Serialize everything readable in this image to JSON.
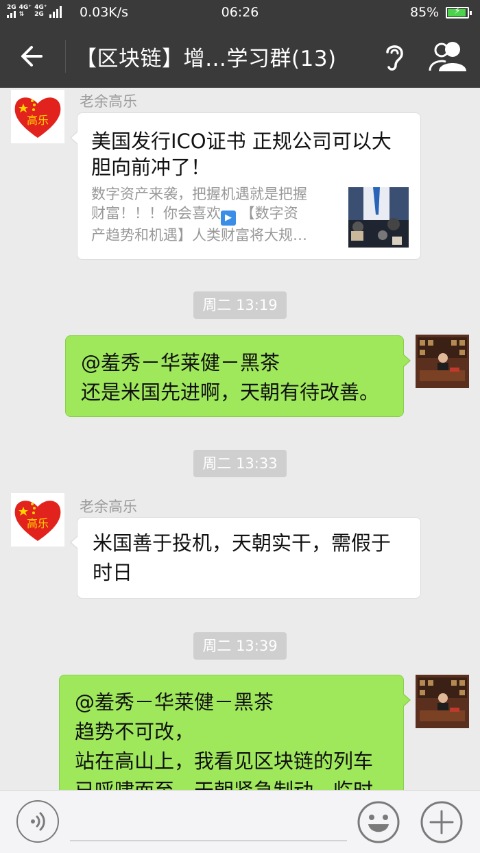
{
  "status_bar": {
    "signal_text_1": "2G",
    "signal_text_2": "4G⁺",
    "signal_text_3": "4G⁺",
    "signal_text_4": "2G",
    "speed": "0.03K/s",
    "time": "06:26",
    "battery": "85%",
    "battery_level": 0.85
  },
  "header": {
    "title": "【区块链】增…学习群(13)",
    "icons": [
      "back-arrow-icon",
      "ear-icon",
      "group-people-icon"
    ]
  },
  "messages": [
    {
      "type": "link_card",
      "side": "left",
      "sender": "老余高乐",
      "avatar_text": "高乐",
      "card_title_line1": "美国发行ICO证书 正规公司可以大",
      "card_title_line2": "胆向前冲了！",
      "card_desc_line1": "数字资产来袭，把握机遇就是把握",
      "card_desc_line2_a": "财富！！！你会喜欢",
      "card_desc_line2_b": " 【数字资",
      "card_desc_line3": "产趋势和机遇】人类财富将大规…"
    },
    {
      "type": "timestamp",
      "text": "周二 13:19"
    },
    {
      "type": "text",
      "side": "right",
      "lines": [
        "@羞秀－华莱健－黑茶",
        "还是米国先进啊，天朝有待改善。"
      ]
    },
    {
      "type": "timestamp",
      "text": "周二 13:33"
    },
    {
      "type": "text",
      "side": "left",
      "sender": "老余高乐",
      "avatar_text": "高乐",
      "lines": [
        "米国善于投机，天朝实干，需假于",
        "时日"
      ]
    },
    {
      "type": "timestamp",
      "text": "周二 13:39"
    },
    {
      "type": "text",
      "side": "right",
      "lines": [
        "@羞秀－华莱健－黑茶",
        "趋势不可改，",
        "站在高山上，我看见区块链的列车",
        "已呼啸而至，天朝紧急制动，临时"
      ]
    }
  ],
  "input_bar": {
    "placeholder": "",
    "icons": [
      "voice-icon",
      "emoji-icon",
      "plus-icon"
    ]
  },
  "colors": {
    "header_bg": "#3a3a3a",
    "chat_bg": "#ebebeb",
    "bubble_self": "#9fe85b",
    "bubble_other": "#ffffff",
    "timestamp_bg": "#cfcfcf"
  }
}
